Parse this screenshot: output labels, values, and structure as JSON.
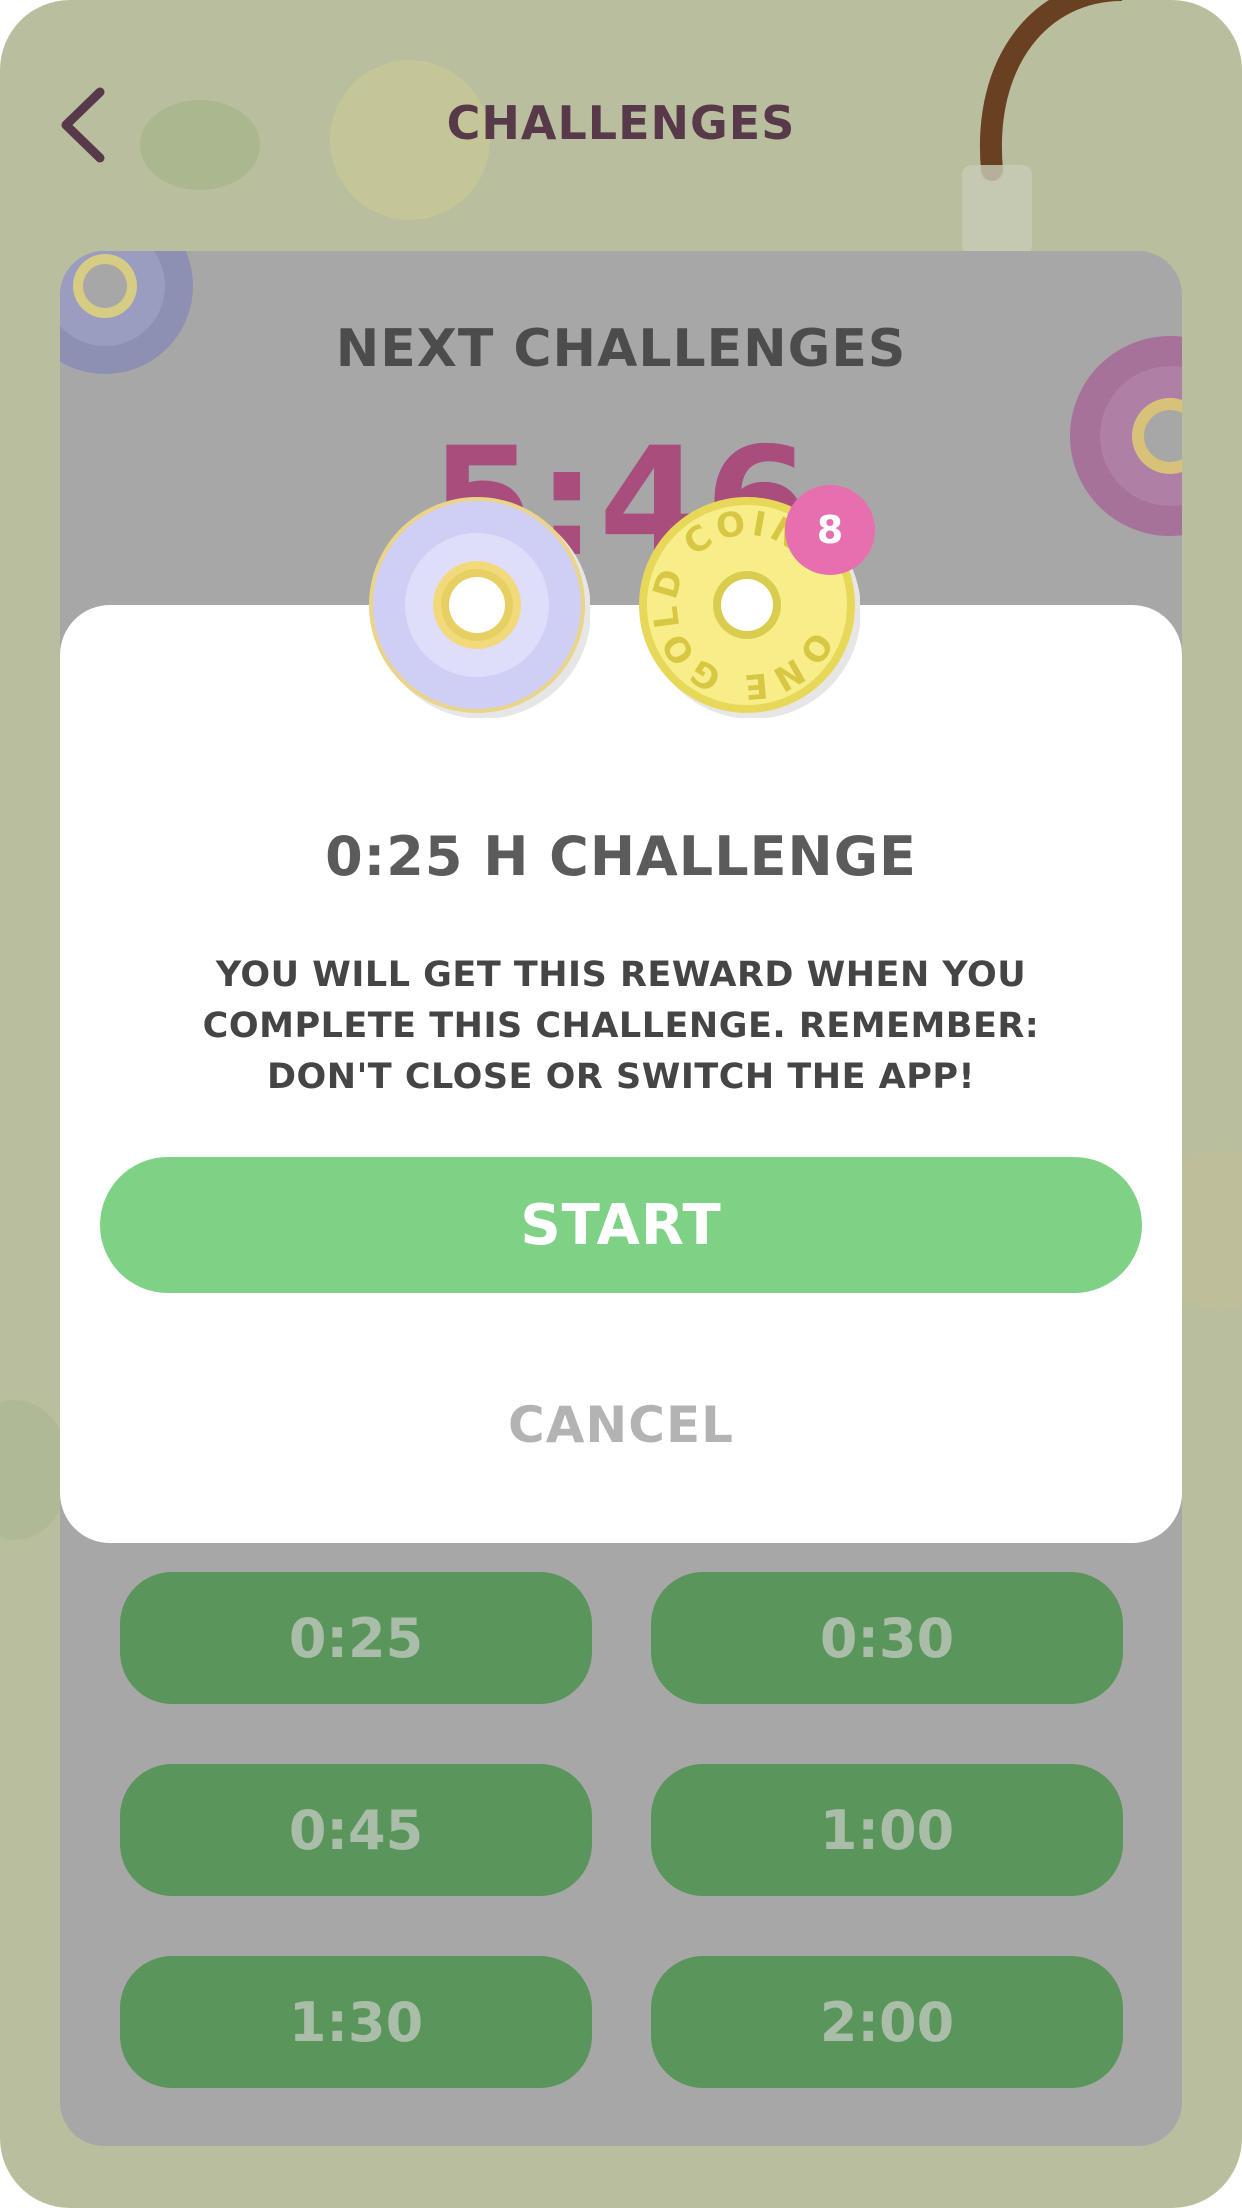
{
  "header": {
    "title": "CHALLENGES"
  },
  "background_card": {
    "title": "NEXT CHALLENGES",
    "timer": "5:46"
  },
  "modal": {
    "title": "0:25 H CHALLENGE",
    "body": "YOU WILL GET THIS REWARD WHEN YOU COMPLETE THIS CHALLENGE. REMEMBER: DON'T CLOSE OR SWITCH THE APP!",
    "start_label": "START",
    "cancel_label": "CANCEL"
  },
  "reward": {
    "coin_text": "ONE GOLD COIN",
    "badge_count": "8"
  },
  "durations": [
    {
      "label": "0:25"
    },
    {
      "label": "0:30"
    },
    {
      "label": "0:45"
    },
    {
      "label": "1:00"
    },
    {
      "label": "1:30"
    },
    {
      "label": "2:00"
    }
  ],
  "colors": {
    "background": "#b9bf9e",
    "card": "#a7a7a7",
    "timer": "#a94d7c",
    "start_button": "#7fd285",
    "duration_button": "#5a955b",
    "badge": "#e76fb0",
    "header_title": "#57394a"
  },
  "icons": {
    "back": "chevron-left-icon",
    "reward_donut": "donut-icon",
    "reward_coin": "gold-coin-icon"
  }
}
